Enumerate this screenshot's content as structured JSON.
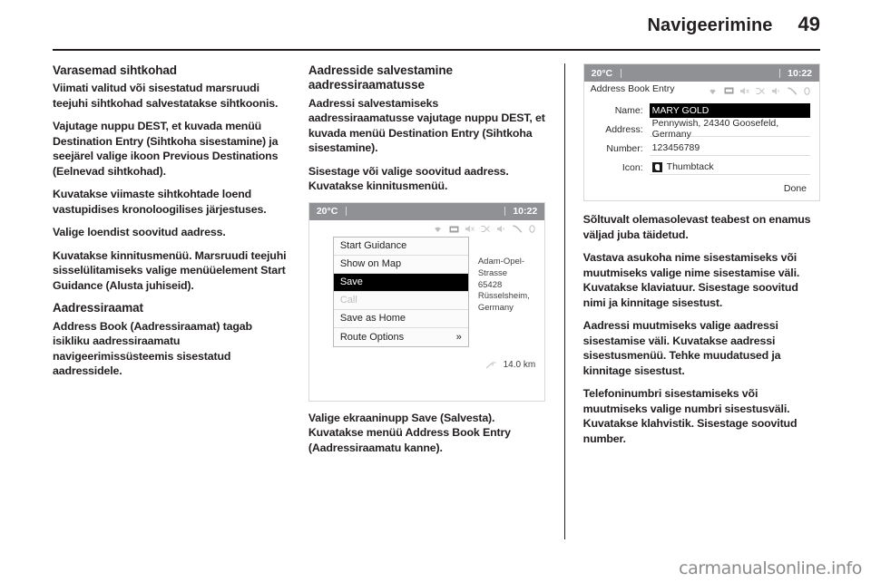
{
  "header": {
    "title": "Navigeerimine",
    "page_number": "49"
  },
  "footer": {
    "watermark": "carmanualsonline.info"
  },
  "column1": {
    "heading": "Varasemad sihtkohad",
    "p1": "Viimati valitud või sisestatud marsruudi teejuhi sihtkohad salvestatakse sihtkoonis.",
    "p2": "Vajutage nuppu DEST, et kuvada menüü Destination Entry (Sihtkoha sisestamine) ja seejärel valige ikoon Previous Destinations (Eelnevad sihtkohad).",
    "p3": "Kuvatakse viimaste sihtkohtade loend vastupidises kronoloogilises järjestuses.",
    "p4": "Valige loendist soovitud aadress.",
    "p5": "Kuvatakse kinnitusmenüü. Marsruudi teejuhi sisselülitamiseks valige menüüelement Start Guidance (Alusta juhiseid).",
    "heading2": "Aadressiraamat",
    "p6": "Address Book (Aadressiraamat) tagab isikliku aadressiraamatu navigeerimissüsteemis sisestatud aadressidele."
  },
  "column2": {
    "heading": "Aadresside salvestamine aadressiraamatusse",
    "p1": "Aadressi salvestamiseks aadressiraamatusse vajutage nuppu DEST, et kuvada menüü Destination Entry (Sihtkoha sisestamine).",
    "p2": "Sisestage või valige soovitud aadress. Kuvatakse kinnitusmenüü.",
    "caption": "Valige ekraaninupp Save (Salvesta). Kuvatakse menüü Address Book Entry (Aadressiraamatu kanne).",
    "screenshot": {
      "name": "destination-confirm-screen",
      "statusbar": {
        "temperature": "20°C",
        "clock": "10:22"
      },
      "status_icons": [
        "wifi-icon",
        "cassette-icon",
        "mute-icon",
        "shuffle-icon",
        "speaker-mute-icon",
        "phone-icon",
        "zero-icon"
      ],
      "menu_items": [
        {
          "label": "Start Guidance",
          "state": "normal",
          "chevron": ""
        },
        {
          "label": "Show on Map",
          "state": "normal",
          "chevron": ""
        },
        {
          "label": "Save",
          "state": "selected",
          "chevron": ""
        },
        {
          "label": "Call",
          "state": "disabled",
          "chevron": ""
        },
        {
          "label": "Save as Home",
          "state": "normal",
          "chevron": ""
        },
        {
          "label": "Route Options",
          "state": "normal",
          "chevron": "»"
        }
      ],
      "address_line1": "Adam-Opel-Strasse",
      "address_line2": "65428 Rüsselsheim, Germany",
      "distance": "14.0 km"
    }
  },
  "column3": {
    "p1": "Sõltuvalt olemasolevast teabest on enamus väljad juba täidetud.",
    "p2": "Vastava asukoha nime sisestamiseks või muutmiseks valige nime sisestamise väli. Kuvatakse klaviatuur. Sisestage soovitud nimi ja kinnitage sisestust.",
    "p3": "Aadressi muutmiseks valige aadressi sisestamise väli. Kuvatakse aadressi sisestusmenüü. Tehke muudatused ja kinnitage sisestust.",
    "p4": "Telefoninumbri sisestamiseks või muutmiseks valige numbri sisestusväli. Kuvatakse klahvistik. Sisestage soovitud number.",
    "screenshot": {
      "name": "address-book-entry-screen",
      "statusbar": {
        "temperature": "20°C",
        "clock": "10:22"
      },
      "title": "Address Book Entry",
      "status_icons": [
        "wifi-icon",
        "cassette-icon",
        "mute-icon",
        "shuffle-icon",
        "speaker-mute-icon",
        "phone-icon",
        "zero-icon"
      ],
      "fields": [
        {
          "label": "Name:",
          "value": "MARY GOLD",
          "highlighted": true
        },
        {
          "label": "Address:",
          "value": "Pennywish, 24340 Goosefeld, Germany",
          "highlighted": false
        },
        {
          "label": "Number:",
          "value": "123456789",
          "highlighted": false
        },
        {
          "label": "Icon:",
          "value": "Thumbtack",
          "highlighted": false
        }
      ],
      "done_label": "Done"
    }
  }
}
